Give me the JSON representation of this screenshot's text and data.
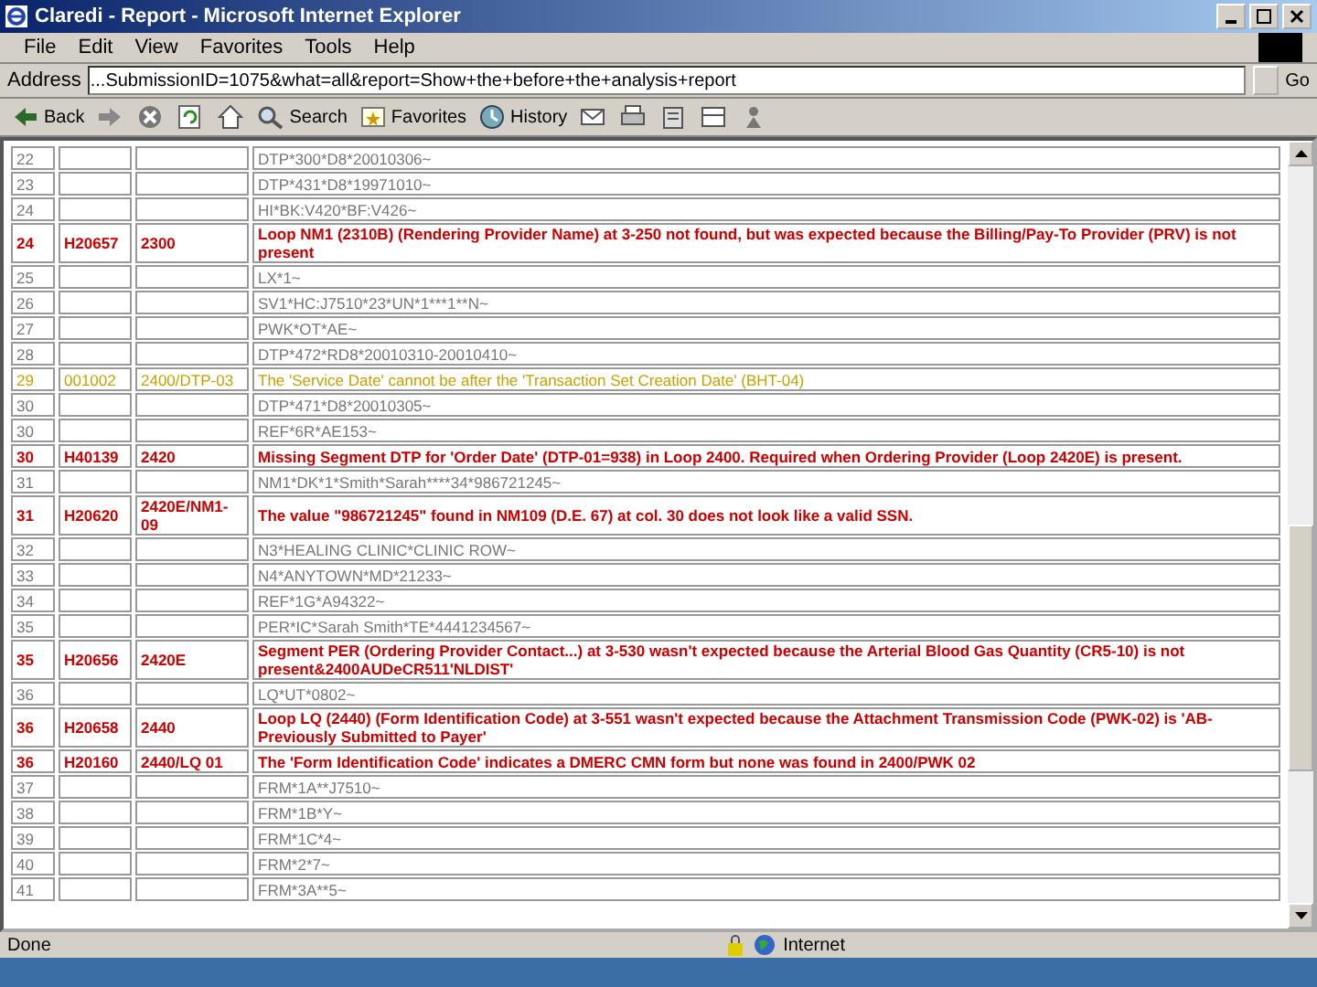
{
  "window": {
    "title": "Claredi - Report - Microsoft Internet Explorer"
  },
  "menu": [
    "File",
    "Edit",
    "View",
    "Favorites",
    "Tools",
    "Help"
  ],
  "address": {
    "label": "Address",
    "value": "...SubmissionID=1075&what=all&report=Show+the+before+the+analysis+report",
    "go": "Go"
  },
  "toolbar": [
    {
      "kind": "back",
      "label": "Back"
    },
    {
      "kind": "forward"
    },
    {
      "kind": "stop"
    },
    {
      "kind": "refresh"
    },
    {
      "kind": "home"
    },
    {
      "kind": "search",
      "label": "Search"
    },
    {
      "kind": "favorites",
      "label": "Favorites"
    },
    {
      "kind": "history",
      "label": "History"
    },
    {
      "kind": "mail"
    },
    {
      "kind": "print"
    },
    {
      "kind": "edit"
    },
    {
      "kind": "discuss"
    },
    {
      "kind": "messenger"
    }
  ],
  "rows": [
    {
      "kind": "segment",
      "line": "22",
      "code": "",
      "loop": "",
      "text": "DTP*300*D8*20010306~"
    },
    {
      "kind": "segment",
      "line": "23",
      "code": "",
      "loop": "",
      "text": "DTP*431*D8*19971010~"
    },
    {
      "kind": "segment",
      "line": "24",
      "code": "",
      "loop": "",
      "text": "HI*BK:V420*BF:V426~"
    },
    {
      "kind": "error",
      "line": "24",
      "code": "H20657",
      "loop": "2300",
      "text": "Loop NM1 (2310B) (Rendering Provider Name) at 3-250 not found, but was expected because the Billing/Pay-To Provider (PRV) is not present"
    },
    {
      "kind": "segment",
      "line": "25",
      "code": "",
      "loop": "",
      "text": "LX*1~"
    },
    {
      "kind": "segment",
      "line": "26",
      "code": "",
      "loop": "",
      "text": "SV1*HC:J7510*23*UN*1***1**N~"
    },
    {
      "kind": "segment",
      "line": "27",
      "code": "",
      "loop": "",
      "text": "PWK*OT*AE~"
    },
    {
      "kind": "segment",
      "line": "28",
      "code": "",
      "loop": "",
      "text": "DTP*472*RD8*20010310-20010410~"
    },
    {
      "kind": "warning",
      "line": "29",
      "code": "001002",
      "loop": "2400/DTP-03",
      "text": "The 'Service Date' cannot be after the 'Transaction Set Creation Date' (BHT-04)"
    },
    {
      "kind": "segment",
      "line": "30",
      "code": "",
      "loop": "",
      "text": "DTP*471*D8*20010305~"
    },
    {
      "kind": "segment",
      "line": "30",
      "code": "",
      "loop": "",
      "text": "REF*6R*AE153~"
    },
    {
      "kind": "error",
      "line": "30",
      "code": "H40139",
      "loop": "2420",
      "text": "Missing Segment DTP for 'Order Date' (DTP-01=938) in Loop 2400. Required when Ordering Provider (Loop 2420E) is present."
    },
    {
      "kind": "segment",
      "line": "31",
      "code": "",
      "loop": "",
      "text": "NM1*DK*1*Smith*Sarah****34*986721245~"
    },
    {
      "kind": "error",
      "line": "31",
      "code": "H20620",
      "loop": "2420E/NM1-09",
      "text": "The value \"986721245\" found in NM109 (D.E. 67) at col. 30 does not look like a valid SSN."
    },
    {
      "kind": "segment",
      "line": "32",
      "code": "",
      "loop": "",
      "text": "N3*HEALING CLINIC*CLINIC ROW~"
    },
    {
      "kind": "segment",
      "line": "33",
      "code": "",
      "loop": "",
      "text": "N4*ANYTOWN*MD*21233~"
    },
    {
      "kind": "segment",
      "line": "34",
      "code": "",
      "loop": "",
      "text": "REF*1G*A94322~"
    },
    {
      "kind": "segment",
      "line": "35",
      "code": "",
      "loop": "",
      "text": "PER*IC*Sarah Smith*TE*4441234567~"
    },
    {
      "kind": "error",
      "line": "35",
      "code": "H20656",
      "loop": "2420E",
      "text": "Segment PER (Ordering Provider Contact...) at 3-530 wasn't expected because the Arterial Blood Gas Quantity (CR5-10) is not present&2400AUDeCR511'NLDIST'"
    },
    {
      "kind": "segment",
      "line": "36",
      "code": "",
      "loop": "",
      "text": "LQ*UT*0802~"
    },
    {
      "kind": "error",
      "line": "36",
      "code": "H20658",
      "loop": "2440",
      "text": "Loop LQ (2440) (Form Identification Code) at 3-551 wasn't expected because the Attachment Transmission Code (PWK-02) is 'AB-Previously Submitted to Payer'"
    },
    {
      "kind": "error",
      "line": "36",
      "code": "H20160",
      "loop": "2440/LQ 01",
      "text": "The 'Form Identification Code' indicates a DMERC CMN form but none was found in 2400/PWK 02"
    },
    {
      "kind": "segment",
      "line": "37",
      "code": "",
      "loop": "",
      "text": "FRM*1A**J7510~"
    },
    {
      "kind": "segment",
      "line": "38",
      "code": "",
      "loop": "",
      "text": "FRM*1B*Y~"
    },
    {
      "kind": "segment",
      "line": "39",
      "code": "",
      "loop": "",
      "text": "FRM*1C*4~"
    },
    {
      "kind": "segment",
      "line": "40",
      "code": "",
      "loop": "",
      "text": "FRM*2*7~"
    },
    {
      "kind": "segment",
      "line": "41",
      "code": "",
      "loop": "",
      "text": "FRM*3A**5~"
    }
  ],
  "status_bar": {
    "text": "Done",
    "zone": "Internet"
  }
}
